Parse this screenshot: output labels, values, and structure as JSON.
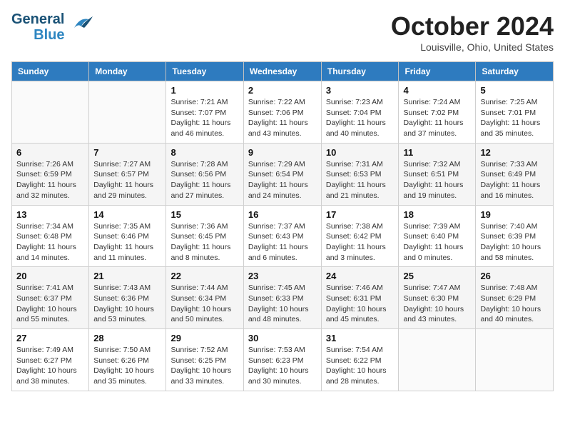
{
  "header": {
    "logo_line1": "General",
    "logo_line2": "Blue",
    "month": "October 2024",
    "location": "Louisville, Ohio, United States"
  },
  "days_of_week": [
    "Sunday",
    "Monday",
    "Tuesday",
    "Wednesday",
    "Thursday",
    "Friday",
    "Saturday"
  ],
  "weeks": [
    [
      {
        "day": "",
        "info": ""
      },
      {
        "day": "",
        "info": ""
      },
      {
        "day": "1",
        "info": "Sunrise: 7:21 AM\nSunset: 7:07 PM\nDaylight: 11 hours and 46 minutes."
      },
      {
        "day": "2",
        "info": "Sunrise: 7:22 AM\nSunset: 7:06 PM\nDaylight: 11 hours and 43 minutes."
      },
      {
        "day": "3",
        "info": "Sunrise: 7:23 AM\nSunset: 7:04 PM\nDaylight: 11 hours and 40 minutes."
      },
      {
        "day": "4",
        "info": "Sunrise: 7:24 AM\nSunset: 7:02 PM\nDaylight: 11 hours and 37 minutes."
      },
      {
        "day": "5",
        "info": "Sunrise: 7:25 AM\nSunset: 7:01 PM\nDaylight: 11 hours and 35 minutes."
      }
    ],
    [
      {
        "day": "6",
        "info": "Sunrise: 7:26 AM\nSunset: 6:59 PM\nDaylight: 11 hours and 32 minutes."
      },
      {
        "day": "7",
        "info": "Sunrise: 7:27 AM\nSunset: 6:57 PM\nDaylight: 11 hours and 29 minutes."
      },
      {
        "day": "8",
        "info": "Sunrise: 7:28 AM\nSunset: 6:56 PM\nDaylight: 11 hours and 27 minutes."
      },
      {
        "day": "9",
        "info": "Sunrise: 7:29 AM\nSunset: 6:54 PM\nDaylight: 11 hours and 24 minutes."
      },
      {
        "day": "10",
        "info": "Sunrise: 7:31 AM\nSunset: 6:53 PM\nDaylight: 11 hours and 21 minutes."
      },
      {
        "day": "11",
        "info": "Sunrise: 7:32 AM\nSunset: 6:51 PM\nDaylight: 11 hours and 19 minutes."
      },
      {
        "day": "12",
        "info": "Sunrise: 7:33 AM\nSunset: 6:49 PM\nDaylight: 11 hours and 16 minutes."
      }
    ],
    [
      {
        "day": "13",
        "info": "Sunrise: 7:34 AM\nSunset: 6:48 PM\nDaylight: 11 hours and 14 minutes."
      },
      {
        "day": "14",
        "info": "Sunrise: 7:35 AM\nSunset: 6:46 PM\nDaylight: 11 hours and 11 minutes."
      },
      {
        "day": "15",
        "info": "Sunrise: 7:36 AM\nSunset: 6:45 PM\nDaylight: 11 hours and 8 minutes."
      },
      {
        "day": "16",
        "info": "Sunrise: 7:37 AM\nSunset: 6:43 PM\nDaylight: 11 hours and 6 minutes."
      },
      {
        "day": "17",
        "info": "Sunrise: 7:38 AM\nSunset: 6:42 PM\nDaylight: 11 hours and 3 minutes."
      },
      {
        "day": "18",
        "info": "Sunrise: 7:39 AM\nSunset: 6:40 PM\nDaylight: 11 hours and 0 minutes."
      },
      {
        "day": "19",
        "info": "Sunrise: 7:40 AM\nSunset: 6:39 PM\nDaylight: 10 hours and 58 minutes."
      }
    ],
    [
      {
        "day": "20",
        "info": "Sunrise: 7:41 AM\nSunset: 6:37 PM\nDaylight: 10 hours and 55 minutes."
      },
      {
        "day": "21",
        "info": "Sunrise: 7:43 AM\nSunset: 6:36 PM\nDaylight: 10 hours and 53 minutes."
      },
      {
        "day": "22",
        "info": "Sunrise: 7:44 AM\nSunset: 6:34 PM\nDaylight: 10 hours and 50 minutes."
      },
      {
        "day": "23",
        "info": "Sunrise: 7:45 AM\nSunset: 6:33 PM\nDaylight: 10 hours and 48 minutes."
      },
      {
        "day": "24",
        "info": "Sunrise: 7:46 AM\nSunset: 6:31 PM\nDaylight: 10 hours and 45 minutes."
      },
      {
        "day": "25",
        "info": "Sunrise: 7:47 AM\nSunset: 6:30 PM\nDaylight: 10 hours and 43 minutes."
      },
      {
        "day": "26",
        "info": "Sunrise: 7:48 AM\nSunset: 6:29 PM\nDaylight: 10 hours and 40 minutes."
      }
    ],
    [
      {
        "day": "27",
        "info": "Sunrise: 7:49 AM\nSunset: 6:27 PM\nDaylight: 10 hours and 38 minutes."
      },
      {
        "day": "28",
        "info": "Sunrise: 7:50 AM\nSunset: 6:26 PM\nDaylight: 10 hours and 35 minutes."
      },
      {
        "day": "29",
        "info": "Sunrise: 7:52 AM\nSunset: 6:25 PM\nDaylight: 10 hours and 33 minutes."
      },
      {
        "day": "30",
        "info": "Sunrise: 7:53 AM\nSunset: 6:23 PM\nDaylight: 10 hours and 30 minutes."
      },
      {
        "day": "31",
        "info": "Sunrise: 7:54 AM\nSunset: 6:22 PM\nDaylight: 10 hours and 28 minutes."
      },
      {
        "day": "",
        "info": ""
      },
      {
        "day": "",
        "info": ""
      }
    ]
  ]
}
